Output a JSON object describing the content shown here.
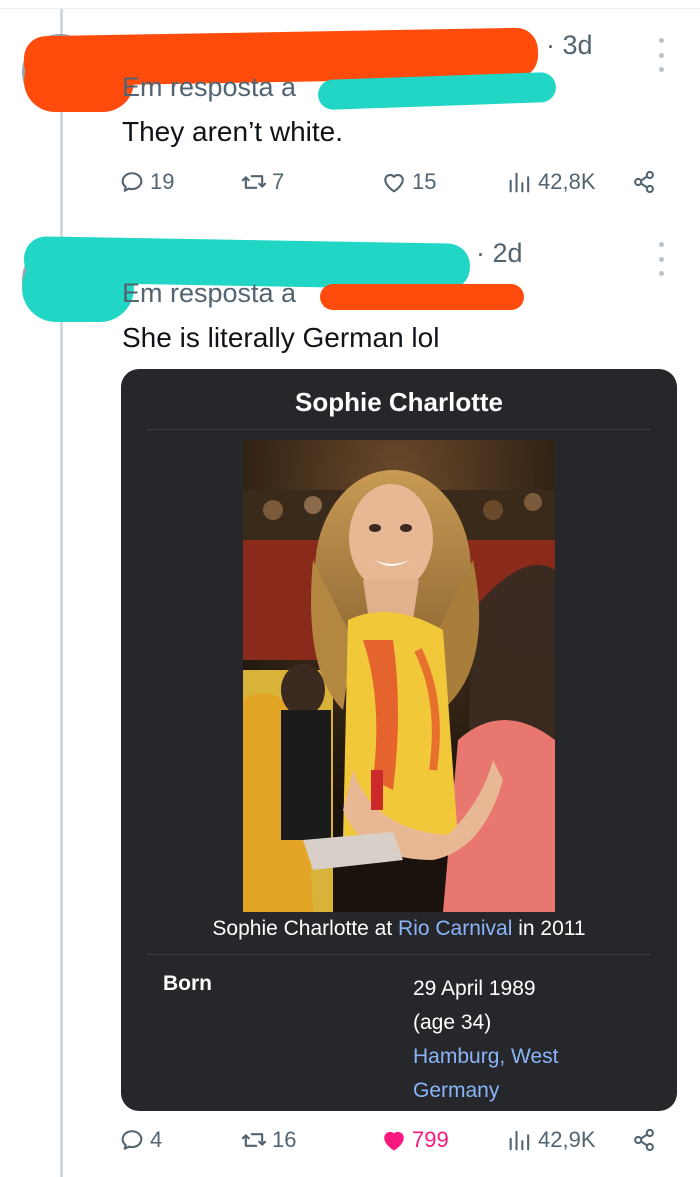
{
  "tweets": [
    {
      "time": "3d",
      "reply_prefix": "Em resposta a",
      "text": "They aren’t white.",
      "stats": {
        "replies": "19",
        "retweets": "7",
        "likes": "15",
        "views": "42,8K"
      },
      "liked": false
    },
    {
      "time": "2d",
      "reply_prefix": "Em resposta a",
      "text": "She is literally German lol",
      "stats": {
        "replies": "4",
        "retweets": "16",
        "likes": "799",
        "views": "42,9K"
      },
      "liked": true,
      "card": {
        "title": "Sophie Charlotte",
        "caption_pre": "Sophie Charlotte at ",
        "caption_link": "Rio Carnival",
        "caption_post": " in 2011",
        "born_label": "Born",
        "born_date": "29 April 1989",
        "born_age": "(age 34)",
        "born_place_1": "Hamburg",
        "born_sep": ", ",
        "born_place_2": "West",
        "born_place_3": "Germany"
      }
    }
  ],
  "colors": {
    "accent_link": "#8ab4f8",
    "like_pink": "#f91880",
    "muted": "#536471",
    "redaction_orange": "#ff4c0c",
    "redaction_teal": "#22d6c6",
    "card_bg": "#26272b"
  },
  "icons": [
    "more-icon",
    "reply-icon",
    "retweet-icon",
    "heart-icon",
    "views-icon",
    "share-icon"
  ]
}
